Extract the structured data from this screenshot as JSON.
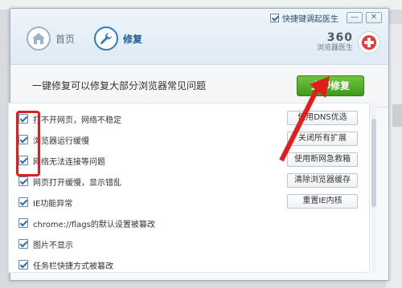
{
  "window": {
    "checkbox_label": "快捷键调起医生",
    "minimize_label": "—",
    "close_label": "✕"
  },
  "nav": {
    "home_label": "首页",
    "repair_label": "修复",
    "home_icon": "home-icon",
    "repair_icon": "wrench-icon"
  },
  "brand": {
    "number": "360",
    "subtitle": "浏览器医生",
    "icon": "medical-cross-icon"
  },
  "action": {
    "title": "一键修复可以修复大部分浏览器常见问题",
    "button_label": "立即修复",
    "button_color": "#4ea925"
  },
  "annotation": {
    "box_color": "#e21d1d",
    "arrow_color": "#e21d1d"
  },
  "items": [
    {
      "label": "打不开网页，网络不稳定",
      "button": "使用DNS优选",
      "checked": true
    },
    {
      "label": "浏览器运行缓慢",
      "button": "关闭所有扩展",
      "checked": true
    },
    {
      "label": "网络无法连接等问题",
      "button": "使用断网急救箱",
      "checked": true
    },
    {
      "label": "网页打开缓慢，显示错乱",
      "button": "清除浏览器缓存",
      "checked": true
    },
    {
      "label": "IE功能异常",
      "button": "重置IE内核",
      "checked": true
    },
    {
      "label": "chrome://flags的默认设置被篡改",
      "button": "",
      "checked": true
    },
    {
      "label": "图片不显示",
      "button": "",
      "checked": true
    },
    {
      "label": "任务栏快捷方式被篡改",
      "button": "",
      "checked": true
    }
  ]
}
